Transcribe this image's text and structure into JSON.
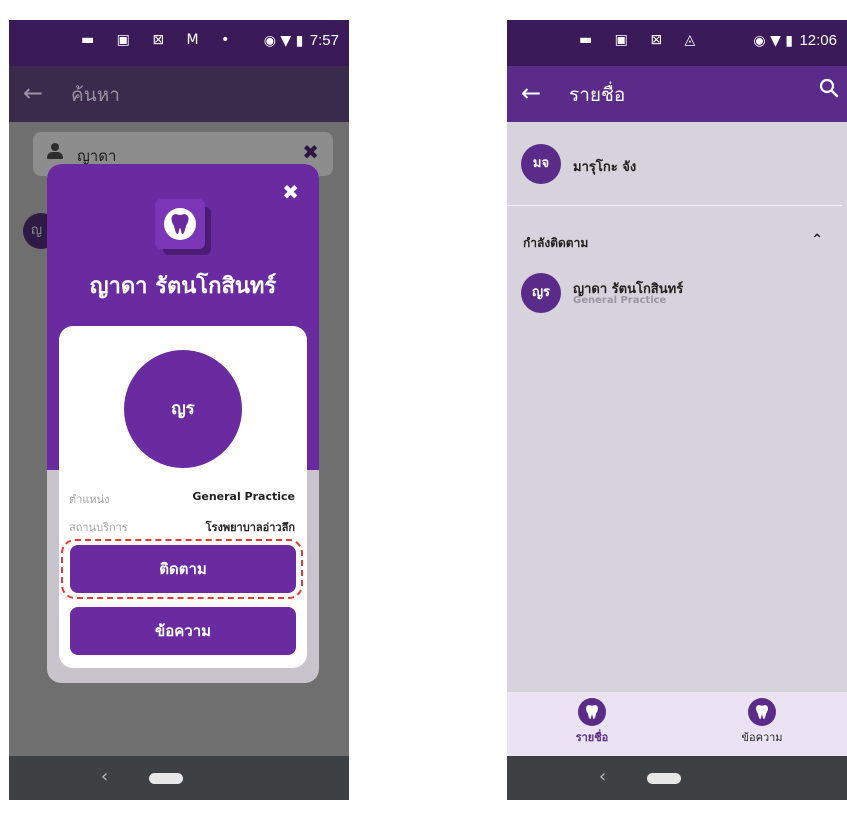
{
  "left": {
    "status": {
      "icons": "▬ ▣ ⊠ M •",
      "right_icons": "◉ ▼ ▮",
      "time": "7:57"
    },
    "app_bar": {
      "back": "←",
      "title": "ค้นหา"
    },
    "search": {
      "value": "ญาดา",
      "clear": "✖"
    },
    "peek_avatar": "ญ",
    "modal": {
      "close": "✖",
      "doctor_name": "ญาดา รัตนโกสินทร์",
      "avatar_initials": "ญร",
      "position_label": "ตำแหน่ง",
      "position_value": "General Practice",
      "location_label": "สถานบริการ",
      "location_value": "โรงพยาบาลอ่าวลึก",
      "follow_button": "ติดตาม",
      "message_button": "ข้อความ"
    },
    "nav": {
      "back": "‹"
    }
  },
  "right": {
    "status": {
      "icons": "▬ ▣ ⊠ ◬",
      "right_icons": "◉ ▼ ▮",
      "time": "12:06"
    },
    "app_bar": {
      "back": "←",
      "title": "รายชื่อ",
      "search": "🔍"
    },
    "contact_self": {
      "initials": "มจ",
      "name": "มารุโกะ จัง"
    },
    "section_title": "กำลังติดตาม",
    "section_chevron": "⌃",
    "following": [
      {
        "initials": "ญร",
        "name": "ญาดา รัตนโกสินทร์",
        "specialty": "General Practice"
      }
    ],
    "tabs": [
      {
        "label": "รายชื่อ",
        "icon": "tooth-icon"
      },
      {
        "label": "ข้อความ",
        "icon": "tooth-icon"
      }
    ],
    "nav": {
      "back": "‹"
    }
  },
  "colors": {
    "brand_purple": "#6a2ba1",
    "status_bar": "#3b1a5a",
    "highlight_red": "#e53935"
  }
}
